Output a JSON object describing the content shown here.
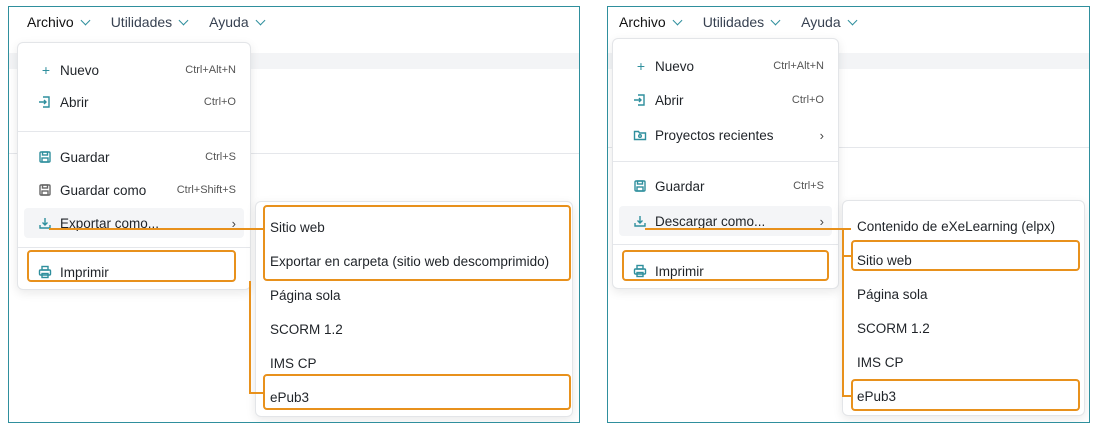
{
  "colors": {
    "accent": "#2f8f9d",
    "highlight": "#e8911c",
    "border": "#2f8f9d"
  },
  "left": {
    "menubar": [
      "Archivo",
      "Utilidades",
      "Ayuda"
    ],
    "menu": {
      "new": {
        "label": "Nuevo",
        "shortcut": "Ctrl+Alt+N",
        "icon": "plus-icon"
      },
      "open": {
        "label": "Abrir",
        "shortcut": "Ctrl+O",
        "icon": "open-file-icon"
      },
      "save": {
        "label": "Guardar",
        "shortcut": "Ctrl+S",
        "icon": "save-icon"
      },
      "save_as": {
        "label": "Guardar como",
        "shortcut": "Ctrl+Shift+S",
        "icon": "save-as-icon"
      },
      "export": {
        "label": "Exportar como...",
        "icon": "download-icon"
      },
      "print": {
        "label": "Imprimir",
        "icon": "printer-icon"
      }
    },
    "submenu": [
      "Sitio web",
      "Exportar en carpeta (sitio web descomprimido)",
      "Página sola",
      "SCORM 1.2",
      "IMS CP",
      "ePub3"
    ]
  },
  "right": {
    "menubar": [
      "Archivo",
      "Utilidades",
      "Ayuda"
    ],
    "menu": {
      "new": {
        "label": "Nuevo",
        "shortcut": "Ctrl+Alt+N",
        "icon": "plus-icon"
      },
      "open": {
        "label": "Abrir",
        "shortcut": "Ctrl+O",
        "icon": "open-file-icon"
      },
      "recent": {
        "label": "Proyectos recientes",
        "icon": "folder-icon"
      },
      "save": {
        "label": "Guardar",
        "shortcut": "Ctrl+S",
        "icon": "save-icon"
      },
      "download": {
        "label": "Descargar como...",
        "icon": "download-icon"
      },
      "print": {
        "label": "Imprimir",
        "icon": "printer-icon"
      }
    },
    "submenu": [
      "Contenido de eXeLearning (elpx)",
      "Sitio web",
      "Página sola",
      "SCORM 1.2",
      "IMS CP",
      "ePub3"
    ]
  }
}
